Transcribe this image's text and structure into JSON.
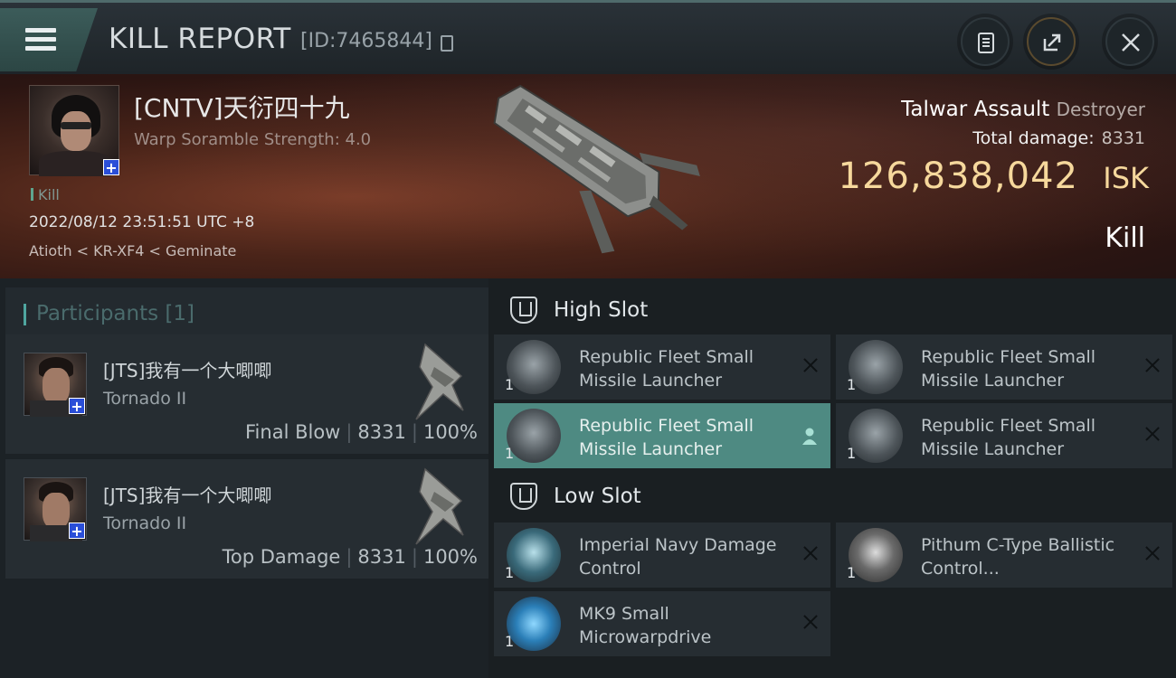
{
  "header": {
    "title": "KILL REPORT",
    "report_id": "[ID:7465844]"
  },
  "victim": {
    "name": "[CNTV]天衍四十九",
    "scramble": "Warp Soramble Strength: 4.0",
    "kill_tag": "Kill",
    "datetime": "2022/08/12 23:51:51 UTC +8",
    "location": "Atioth < KR-XF4 < Geminate",
    "ship_name": "Talwar Assault",
    "ship_class": "Destroyer",
    "total_damage_label": "Total damage:",
    "total_damage_value": "8331",
    "isk_value": "126,838,042",
    "isk_unit": "ISK",
    "status": "Kill"
  },
  "participants": {
    "header": "Participants [1]",
    "rows": [
      {
        "name": "[JTS]我有一个大唧唧",
        "ship": "Tornado II",
        "role": "Final Blow",
        "damage": "8331",
        "percent": "100%"
      },
      {
        "name": "[JTS]我有一个大唧唧",
        "ship": "Tornado II",
        "role": "Top Damage",
        "damage": "8331",
        "percent": "100%"
      }
    ]
  },
  "slots": {
    "high": {
      "label": "High Slot",
      "modules": [
        {
          "name": "Republic Fleet Small Missile Launcher",
          "qty": "1"
        },
        {
          "name": "Republic Fleet Small Missile Launcher",
          "qty": "1"
        },
        {
          "name": "Republic Fleet Small Missile Launcher",
          "qty": "1"
        },
        {
          "name": "Republic Fleet Small Missile Launcher",
          "qty": "1"
        }
      ]
    },
    "low": {
      "label": "Low Slot",
      "modules": [
        {
          "name": "Imperial Navy Damage Control",
          "qty": "1"
        },
        {
          "name": "Pithum C-Type Ballistic Control...",
          "qty": "1"
        },
        {
          "name": "MK9 Small Microwarpdrive",
          "qty": "1"
        }
      ]
    }
  },
  "colors": {
    "isk": "#f6d89c",
    "active_module": "#4e8a82",
    "accent": "#4fa6a0",
    "badge": "#2a4ed8"
  },
  "icons": [
    "menu-icon",
    "copy-icon",
    "clipboard-icon",
    "share-icon",
    "close-icon",
    "plus-icon",
    "slot-icon",
    "pilot-icon",
    "remove-icon"
  ]
}
